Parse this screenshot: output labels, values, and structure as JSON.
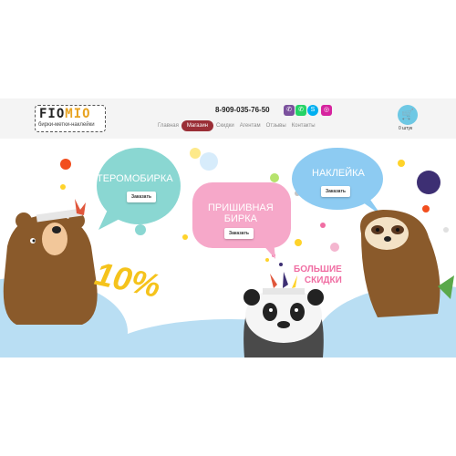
{
  "logo": {
    "text_main": "FIO",
    "text_accent": "MIO",
    "tagline": "бирки-метки-наклейки"
  },
  "header": {
    "phone": "8-909-035-76-50",
    "social_icons": [
      "viber-icon",
      "whatsapp-icon",
      "skype-icon",
      "instagram-icon"
    ],
    "social_colors": [
      "#7b519d",
      "#25d366",
      "#00aff0",
      "#d6249f"
    ]
  },
  "nav": {
    "items": [
      {
        "label": "Главная"
      },
      {
        "label": "Магазин"
      },
      {
        "label": "Скидки"
      },
      {
        "label": "Агентам"
      },
      {
        "label": "Отзывы"
      },
      {
        "label": "Контакты"
      }
    ],
    "active": "Магазин"
  },
  "cart": {
    "count_label": "0 штук",
    "icon": "cart-icon",
    "color": "#6ec8e4"
  },
  "hero": {
    "bubble1": {
      "title": "ТЕРОМОБИРКА",
      "button": "Заказать",
      "color": "#8ad7d2"
    },
    "bubble2": {
      "title_line1": "ПРИШИВНАЯ",
      "title_line2": "БИРКА",
      "button": "Заказать",
      "color": "#f6a8c9"
    },
    "bubble3": {
      "title": "НАКЛЕЙКА",
      "button": "Заказать",
      "color": "#8dcbf2"
    },
    "discount_value": "10%",
    "promo_line1": "БОЛЬШИЕ",
    "promo_line2": "СКИДКИ"
  },
  "colors": {
    "accent": "#9a2e36",
    "promo": "#f06ea3",
    "percent": "#f5c31c",
    "ground": "#b9def3"
  }
}
